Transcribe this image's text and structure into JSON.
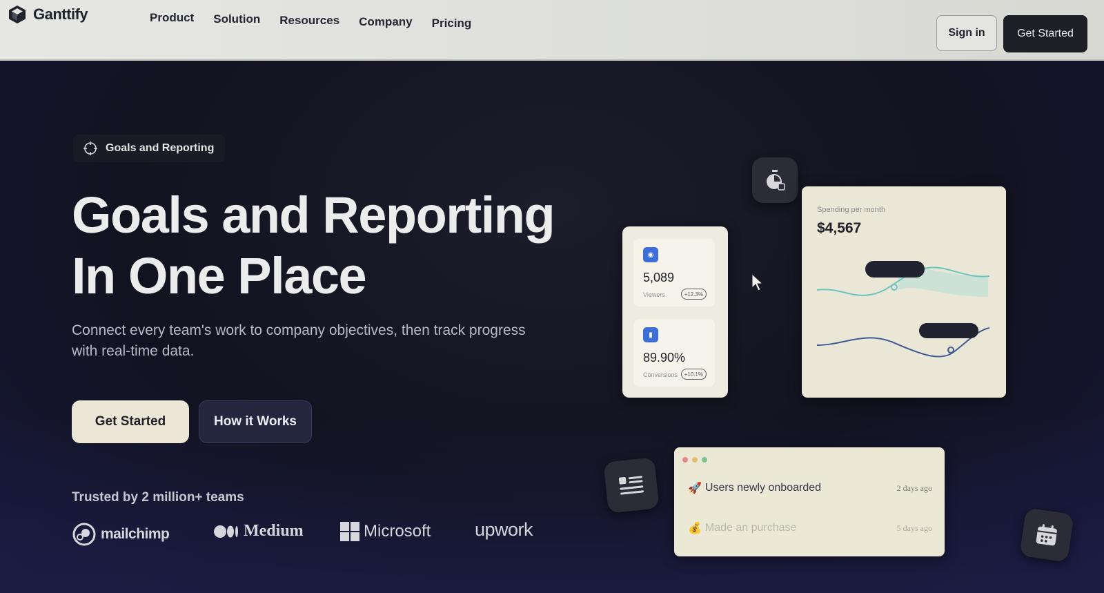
{
  "nav": {
    "brand": "Ganttify",
    "links": [
      "Product",
      "Solution",
      "Resources",
      "Company",
      "Pricing"
    ],
    "sign_in": "Sign in",
    "get_started": "Get Started"
  },
  "hero": {
    "badge": "Goals and Reporting",
    "title_line1": "Goals and Reporting",
    "title_line2": "In One Place",
    "description": "Connect every team's work to company objectives, then track progress with real-time data.",
    "cta_primary": "Get Started",
    "cta_secondary": "How it Works",
    "trusted": "Trusted by 2 million+ teams"
  },
  "brands": [
    "mailchimp",
    "Medium",
    "Microsoft",
    "upwork"
  ],
  "stats_card": {
    "stats": [
      {
        "value": "5,089",
        "label": "Viewers",
        "change": "+12.3%"
      },
      {
        "value": "89.90%",
        "label": "Conversions",
        "change": "+10.1%"
      }
    ]
  },
  "spend_card": {
    "label": "Spending per month",
    "value": "$4,567"
  },
  "activity_card": {
    "items": [
      {
        "title": "Users newly onboarded",
        "time": "2 days ago"
      },
      {
        "title": "Made an purchase",
        "time": "5 days ago"
      }
    ]
  },
  "colors": {
    "accent_blue": "#3d6fd6",
    "card_bg": "#ebe7d6",
    "dark_bg": "#16172a"
  }
}
